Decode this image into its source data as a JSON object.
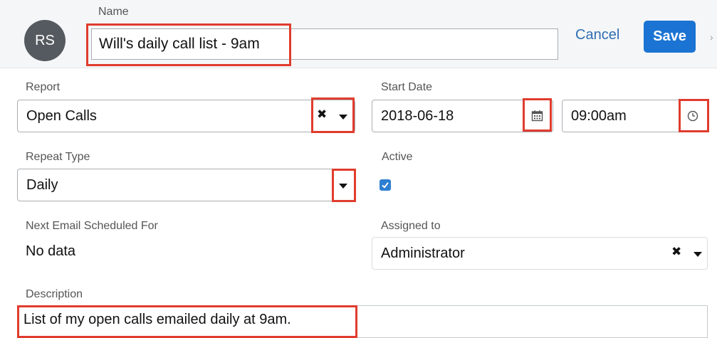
{
  "header": {
    "avatar_initials": "RS",
    "name_label": "Name",
    "name_value": "Will's daily call list - 9am",
    "cancel_label": "Cancel",
    "save_label": "Save"
  },
  "fields": {
    "report": {
      "label": "Report",
      "value": "Open Calls"
    },
    "start_date": {
      "label": "Start Date",
      "date": "2018-06-18",
      "time": "09:00am"
    },
    "repeat_type": {
      "label": "Repeat Type",
      "value": "Daily"
    },
    "active": {
      "label": "Active",
      "checked": true
    },
    "next_email": {
      "label": "Next Email Scheduled For",
      "value": "No data"
    },
    "assigned_to": {
      "label": "Assigned to",
      "value": "Administrator"
    },
    "description": {
      "label": "Description",
      "value": "List of my open calls emailed daily at 9am."
    }
  },
  "icons": {
    "clear": "clear-x-icon",
    "caret": "caret-down-icon",
    "calendar": "calendar-icon",
    "clock": "clock-icon",
    "checkmark": "checkmark-icon",
    "chevron": "chevron-right-icon"
  },
  "colors": {
    "accent": "#1b74d3",
    "link": "#2e6db4",
    "highlight": "#e03c2e",
    "avatar_bg": "#555a60",
    "checkbox": "#2e7fd1"
  }
}
